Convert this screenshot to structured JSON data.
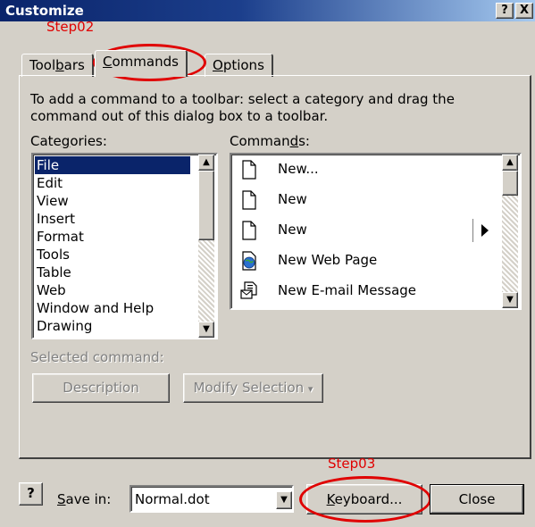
{
  "window": {
    "title": "Customize",
    "help_button": "?",
    "close_button": "X"
  },
  "annotations": {
    "step02": "Step02",
    "step03": "Step03",
    "ring_color": "#e00000"
  },
  "tabs": [
    {
      "label": "Toolbars",
      "active": false
    },
    {
      "label": "Commands",
      "active": true
    },
    {
      "label": "Options",
      "active": false
    }
  ],
  "instructions": {
    "line1": "To add a command to a toolbar: select a category and drag the",
    "line2": "command out of this dialog box to a toolbar."
  },
  "categories": {
    "label": "Categories:",
    "items": [
      "File",
      "Edit",
      "View",
      "Insert",
      "Format",
      "Tools",
      "Table",
      "Web",
      "Window and Help",
      "Drawing"
    ],
    "selected": "File"
  },
  "commands": {
    "label": "Commands:",
    "items": [
      {
        "label": "New...",
        "icon": "blank-page-icon"
      },
      {
        "label": "New",
        "icon": "blank-page-icon"
      },
      {
        "label": "New",
        "icon": "blank-page-icon",
        "has_submenu": true
      },
      {
        "label": "New Web Page",
        "icon": "web-page-icon"
      },
      {
        "label": "New E-mail Message",
        "icon": "email-message-icon"
      }
    ]
  },
  "selected_command": {
    "label": "Selected command:",
    "description_button": "Description",
    "modify_selection_button": "Modify Selection",
    "modify_selection_arrow": "▾"
  },
  "footer": {
    "help_icon": "?",
    "save_in_label": "Save in:",
    "save_in_value": "Normal.dot",
    "keyboard_button": "Keyboard...",
    "close_button": "Close"
  },
  "colors": {
    "title_bar": "#0a246a",
    "dialog_bg": "#d4d0c8",
    "selection": "#0a246a"
  }
}
